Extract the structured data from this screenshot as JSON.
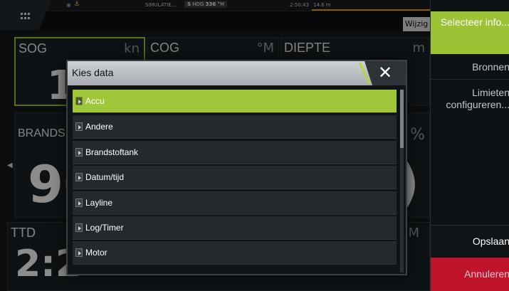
{
  "topbar": {
    "simulation_label": "SIMULATIE...",
    "heading_badge": "S",
    "heading_prefix": "HDG",
    "heading_value": "336",
    "heading_unit": "°M",
    "time": "2:50:43",
    "depth": "14.6 m",
    "wijzig_label": "Wijzig",
    "accent_color": "#f2a623"
  },
  "panels": {
    "sog": {
      "label": "SOG",
      "unit": "kn",
      "value": "1"
    },
    "cog": {
      "label": "COG",
      "unit": "°M"
    },
    "diepte": {
      "label": "DIEPTE",
      "unit": "m"
    },
    "brands": {
      "label": "BRANDS",
      "value": "90"
    },
    "right2": {
      "unit": "%",
      "value": ")"
    },
    "ttd": {
      "label": "TTD",
      "value": "2:2",
      "unit": "M"
    }
  },
  "sidemenu": {
    "selecteer": "Selecteer info...",
    "bronnen": "Bronnen",
    "limieten": "Limieten configureren...",
    "opslaan": "Opslaan",
    "annuleren": "Annuleren",
    "highlight_color": "#9cc236",
    "cancel_color": "#c0142b"
  },
  "dialog": {
    "title": "Kies data",
    "close_icon": "close-icon",
    "items": [
      {
        "label": "Accu",
        "selected": true
      },
      {
        "label": "Andere",
        "selected": false
      },
      {
        "label": "Brandstoftank",
        "selected": false
      },
      {
        "label": "Datum/tijd",
        "selected": false
      },
      {
        "label": "Layline",
        "selected": false
      },
      {
        "label": "Log/Timer",
        "selected": false
      },
      {
        "label": "Motor",
        "selected": false
      }
    ],
    "selected_color": "#a0c63a"
  }
}
